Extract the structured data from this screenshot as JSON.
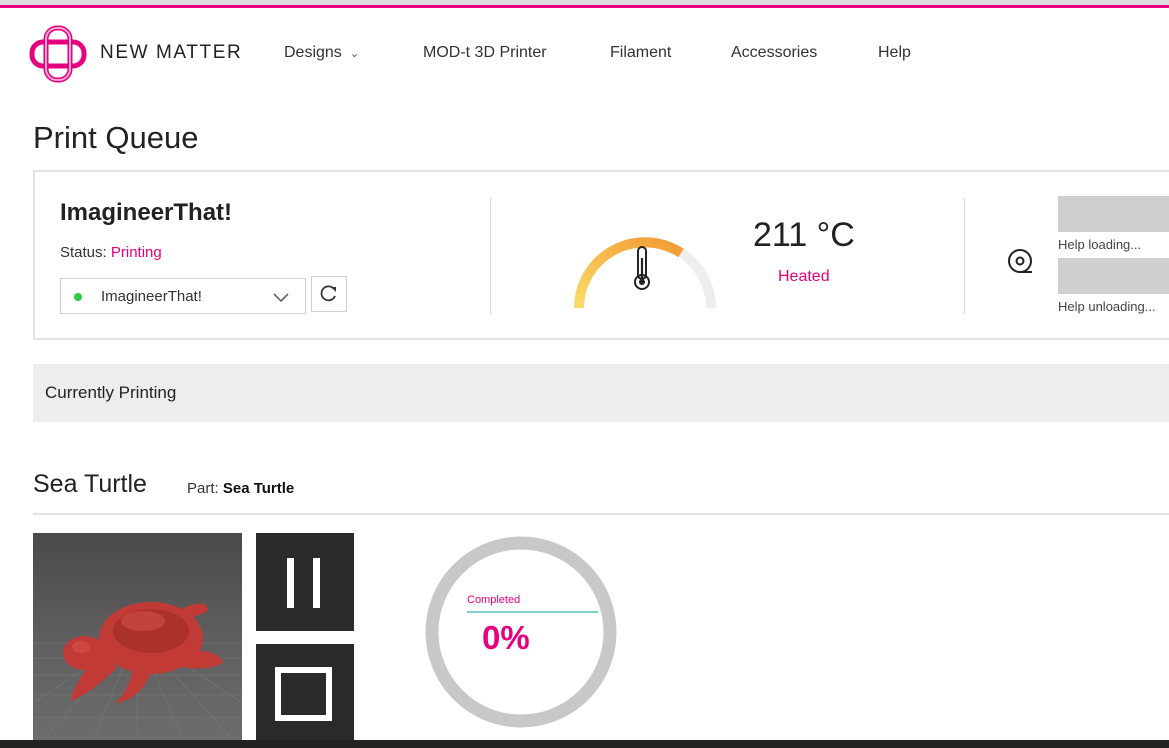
{
  "brand": {
    "name": "NEW MATTER",
    "accent_color": "#e6007e"
  },
  "nav": {
    "items": [
      {
        "label": "Designs",
        "has_dropdown": true
      },
      {
        "label": "MOD-t 3D Printer"
      },
      {
        "label": "Filament"
      },
      {
        "label": "Accessories"
      },
      {
        "label": "Help"
      }
    ]
  },
  "page": {
    "title": "Print Queue"
  },
  "printer": {
    "name": "ImagineerThat!",
    "status_label": "Status:",
    "status_value": "Printing",
    "selected": "ImagineerThat!",
    "online_color": "#2ecc40"
  },
  "temperature": {
    "value": "211 °C",
    "state": "Heated",
    "gauge_fill": 0.5,
    "icon": "thermometer-icon"
  },
  "filament": {
    "icon": "spool-icon",
    "help_loading": "Help loading...",
    "help_unloading": "Help unloading..."
  },
  "current": {
    "section_label": "Currently Printing",
    "job_title": "Sea Turtle",
    "part_label": "Part:",
    "part_name": "Sea Turtle",
    "completed_label": "Completed",
    "completed_value": "0%",
    "progress": 0
  }
}
